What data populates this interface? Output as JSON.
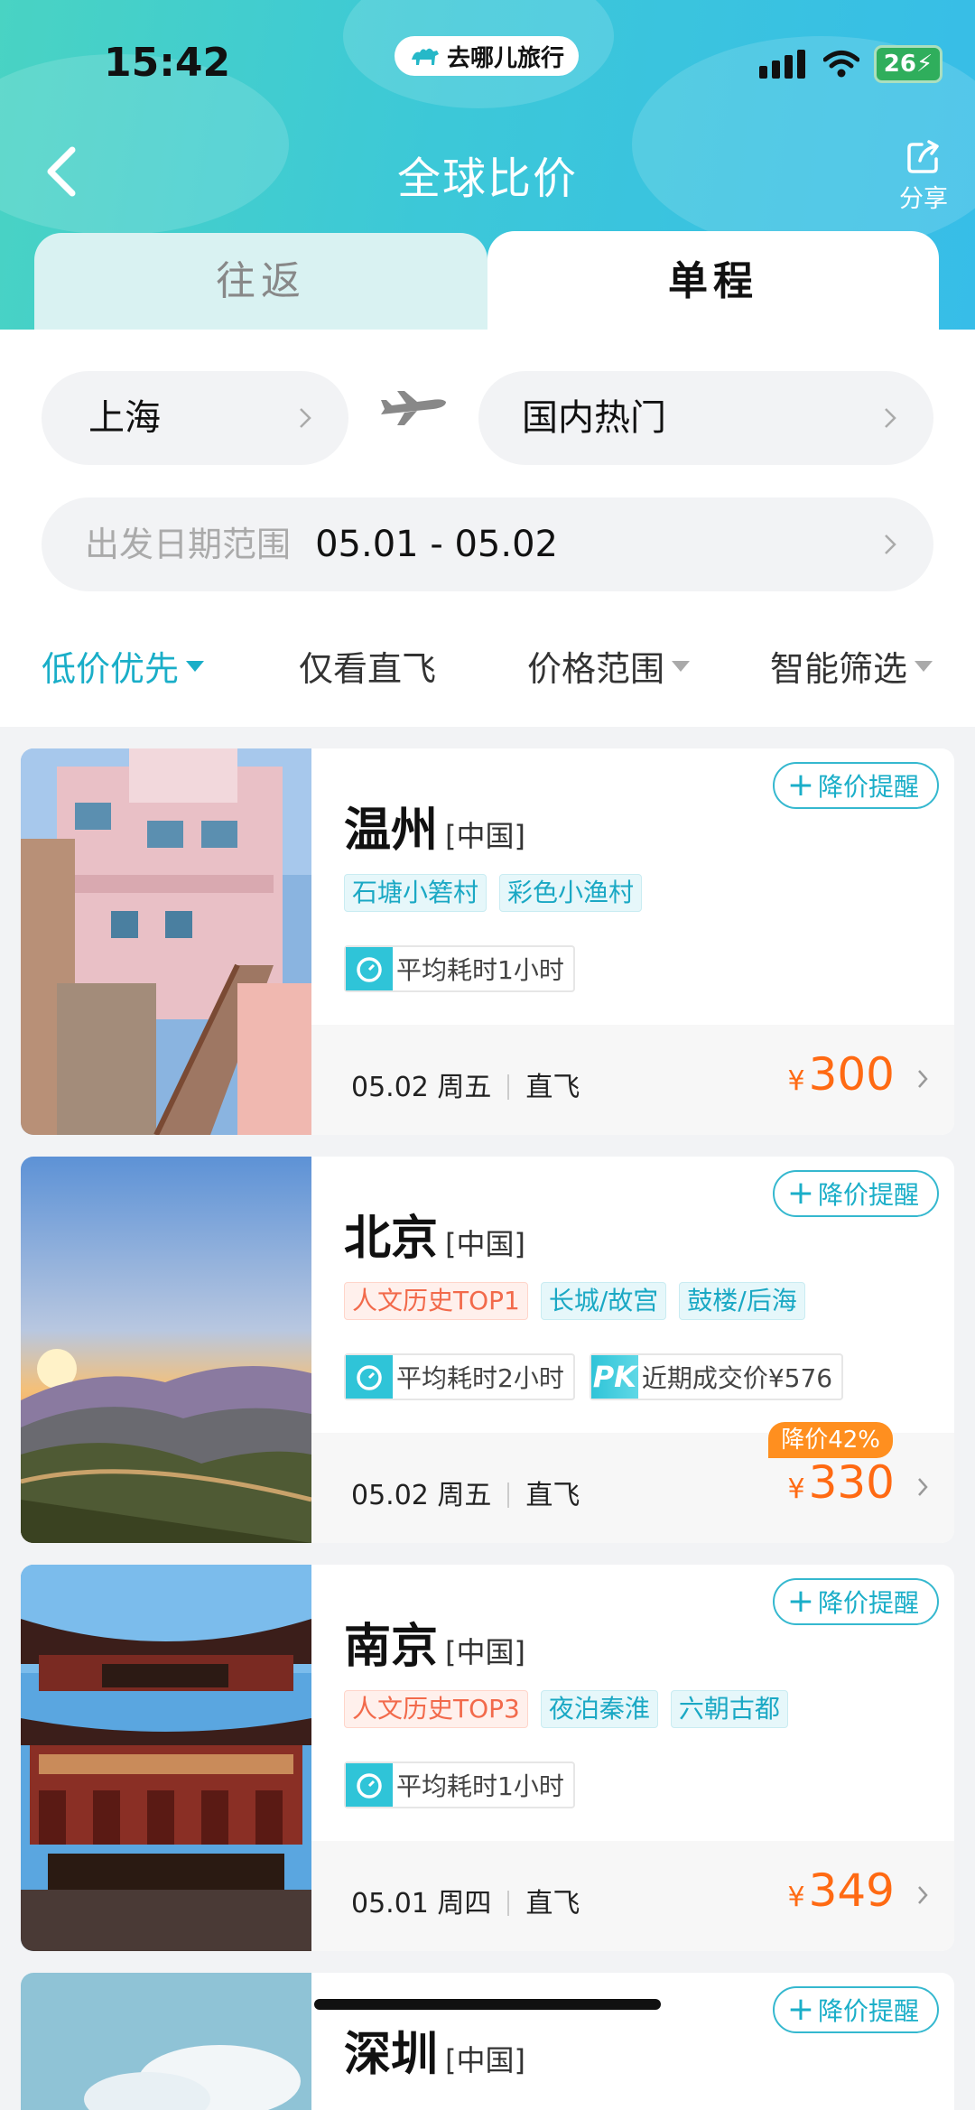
{
  "status_bar": {
    "time": "15:42",
    "battery": "26"
  },
  "brand": {
    "name": "去哪儿旅行"
  },
  "header": {
    "title": "全球比价",
    "share_label": "分享"
  },
  "trip_tabs": [
    {
      "label": "往返",
      "selected": false
    },
    {
      "label": "单程",
      "selected": true
    }
  ],
  "search": {
    "from_city": "上海",
    "to_city": "国内热门",
    "date_label": "出发日期范围",
    "date_value": "05.01 - 05.02"
  },
  "filters": [
    {
      "label": "低价优先",
      "active": true
    },
    {
      "label": "仅看直飞",
      "active": false
    },
    {
      "label": "价格范围",
      "active": false
    },
    {
      "label": "智能筛选",
      "active": false
    }
  ],
  "remind_label": "降价提醒",
  "results": [
    {
      "city": "温州",
      "country": "[中国]",
      "tags": [
        {
          "text": "石塘小箬村",
          "style": "teal"
        },
        {
          "text": "彩色小渔村",
          "style": "teal"
        }
      ],
      "avg_time": "平均耗时1小时",
      "date": "05.02 周五",
      "flight_type": "直飞",
      "currency": "¥",
      "price": "300"
    },
    {
      "city": "北京",
      "country": "[中国]",
      "tags": [
        {
          "text": "人文历史TOP1",
          "style": "rank"
        },
        {
          "text": "长城/故宫",
          "style": "teal"
        },
        {
          "text": "鼓楼/后海",
          "style": "teal"
        }
      ],
      "avg_time": "平均耗时2小时",
      "pk_label": "PK",
      "recent_deal": "近期成交价¥576",
      "discount": "降价42%",
      "date": "05.02 周五",
      "flight_type": "直飞",
      "currency": "¥",
      "price": "330"
    },
    {
      "city": "南京",
      "country": "[中国]",
      "tags": [
        {
          "text": "人文历史TOP3",
          "style": "rank"
        },
        {
          "text": "夜泊秦淮",
          "style": "teal"
        },
        {
          "text": "六朝古都",
          "style": "teal"
        }
      ],
      "avg_time": "平均耗时1小时",
      "date": "05.01 周四",
      "flight_type": "直飞",
      "currency": "¥",
      "price": "349"
    },
    {
      "city": "深圳",
      "country": "[中国]"
    }
  ],
  "colors": {
    "accent": "#1aaec8",
    "price": "#ff6a13",
    "header_start": "#49d3c3",
    "header_end": "#37bde8"
  }
}
